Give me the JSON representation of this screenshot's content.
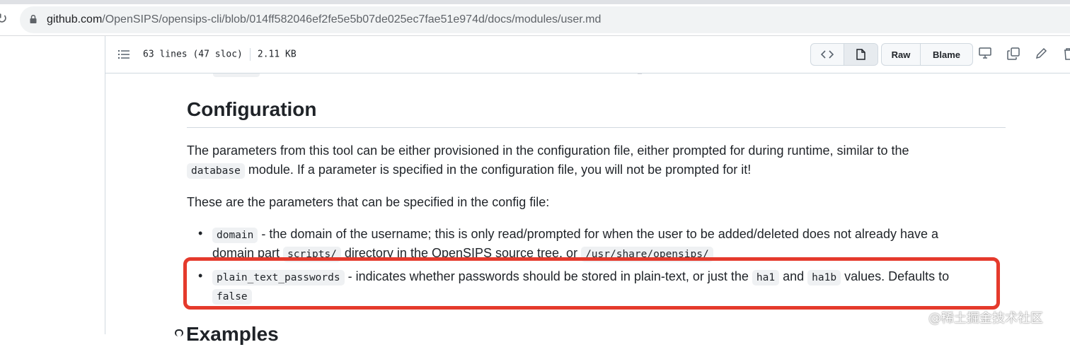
{
  "browser": {
    "url_host": "github.com",
    "url_path": "/OpenSIPS/opensips-cli/blob/014ff582046ef2fe5e5b07de025ec7fae51e974d/docs/modules/user.md"
  },
  "file_header": {
    "lines": "63 lines (47 sloc)",
    "size": "2.11 KB",
    "raw_label": "Raw",
    "blame_label": "Blame"
  },
  "article": {
    "heading": "Configuration",
    "para1_a": "The parameters from this tool can be either provisioned in the configuration file, either prompted for during runtime, similar to the",
    "para1_code": "database",
    "para1_b": " module. If a parameter is specified in the configuration file, you will not be prompted for it!",
    "para2": "These are the parameters that can be specified in the config file:",
    "item1_code": "domain",
    "item1_text": " - the domain of the username; this is only read/prompted for when the user to be added/deleted does not already have a",
    "item1_line2a": "domain part ",
    "item1_code2": "scripts/",
    "item1_line2b": " directory in the OpenSIPS source tree, or ",
    "item1_code3": "/usr/share/opensips/",
    "item2_code": "plain_text_passwords",
    "item2_text_a": " - indicates whether passwords should be stored in plain-text, or just the ",
    "item2_code_ha1": "ha1",
    "item2_and": " and ",
    "item2_code_ha1b": "ha1b",
    "item2_text_b": " values. Defaults to",
    "item2_code_false": "false",
    "next_heading": "Examples"
  },
  "watermark": "@稀土掘金技术社区",
  "colors": {
    "highlight": "#e53a2c",
    "code_bg": "#eff1f3",
    "border": "#d1d9e0"
  }
}
